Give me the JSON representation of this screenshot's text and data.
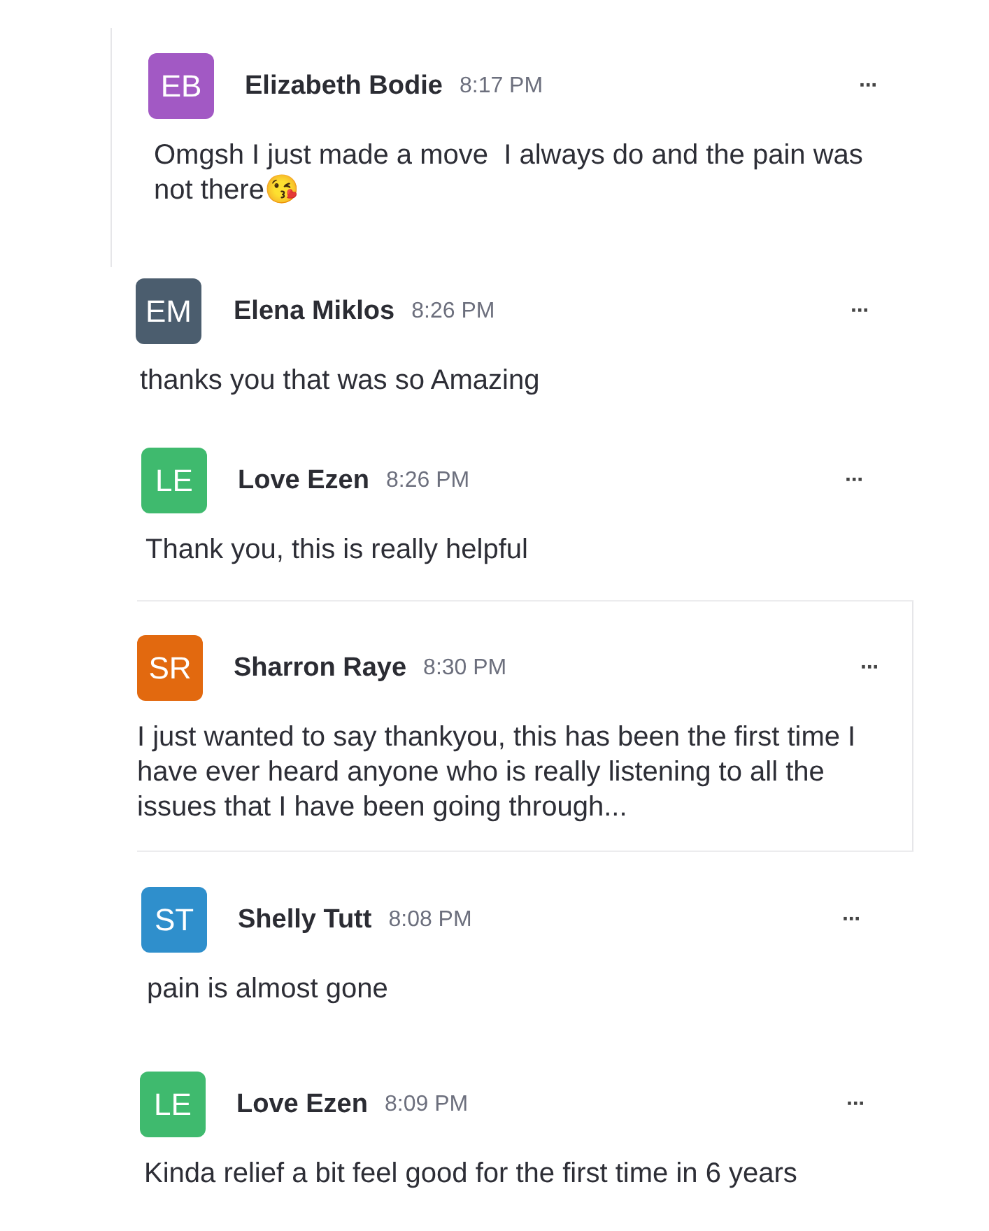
{
  "messages": [
    {
      "initials": "EB",
      "color": "#a259c4",
      "name": "Elizabeth Bodie",
      "time": "8:17 PM",
      "more": "···",
      "text": "Omgsh I just made a move  I always do and the pain was not there😘"
    },
    {
      "initials": "EM",
      "color": "#4b5d6e",
      "name": "Elena Miklos",
      "time": "8:26 PM",
      "more": "···",
      "text": "thanks you that was so Amazing"
    },
    {
      "initials": "LE",
      "color": "#3fba6e",
      "name": "Love Ezen",
      "time": "8:26 PM",
      "more": "···",
      "text": "Thank you, this is really helpful"
    },
    {
      "initials": "SR",
      "color": "#e2690f",
      "name": "Sharron Raye",
      "time": "8:30 PM",
      "more": "···",
      "text": "I just wanted to say thankyou, this has been the first time I have ever heard anyone who is really listening to all the issues that I have been going through..."
    },
    {
      "initials": "ST",
      "color": "#2f8fcc",
      "name": "Shelly Tutt",
      "time": "8:08 PM",
      "more": "···",
      "text": "pain is almost gone"
    },
    {
      "initials": "LE",
      "color": "#3fba6e",
      "name": "Love Ezen",
      "time": "8:09 PM",
      "more": "···",
      "text": "Kinda relief a bit feel good for the first time in 6 years"
    }
  ]
}
